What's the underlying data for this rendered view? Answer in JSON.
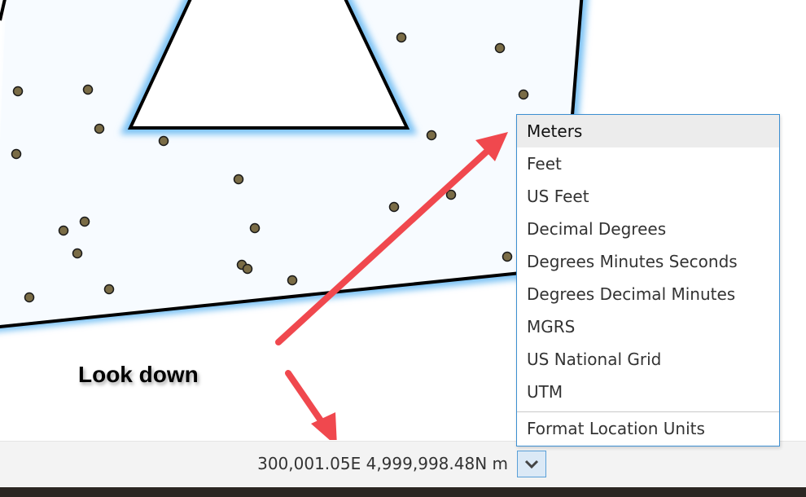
{
  "callout": {
    "text": "Look down"
  },
  "status_bar": {
    "coordinates": "300,001.05E 4,999,998.48N m",
    "units_toggle_icon": "chevron-down-icon"
  },
  "units_menu": {
    "options": [
      "Meters",
      "Feet",
      "US Feet",
      "Decimal Degrees",
      "Degrees Minutes Seconds",
      "Degrees Decimal Minutes",
      "MGRS",
      "US National Grid",
      "UTM"
    ],
    "selected": "Meters",
    "footer": "Format Location Units"
  },
  "colors": {
    "point_fill": "#7a6c46",
    "selection_glow": "#64b4f0",
    "arrow": "#f0484e",
    "menu_border": "#3d8fd1"
  }
}
